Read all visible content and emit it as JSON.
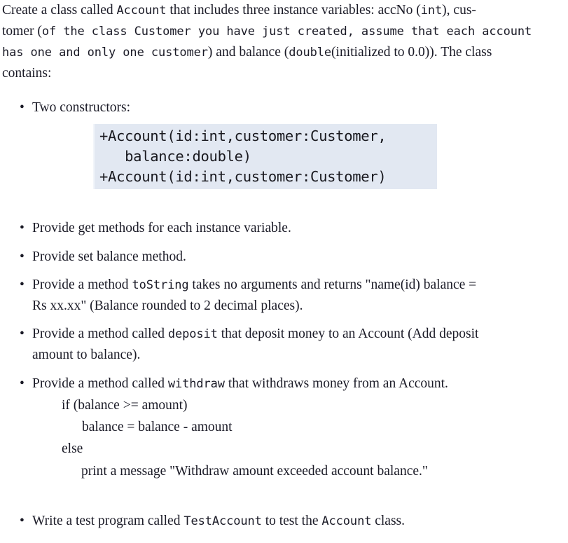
{
  "document": {
    "intro": {
      "lines": [
        [
          {
            "t": "Create a class called ",
            "s": "serif"
          },
          {
            "t": "Account",
            "s": "mono"
          },
          {
            "t": " that includes three instance variables: accNo (",
            "s": "serif"
          },
          {
            "t": "int",
            "s": "mono"
          },
          {
            "t": "), cus-",
            "s": "serif"
          }
        ],
        [
          {
            "t": "tomer (",
            "s": "serif"
          },
          {
            "t": "of the class Customer you have just created, assume that each account",
            "s": "mono"
          }
        ],
        [
          {
            "t": "has one and only one customer",
            "s": "mono"
          },
          {
            "t": ") and balance (",
            "s": "serif"
          },
          {
            "t": "double",
            "s": "mono"
          },
          {
            "t": "(initialized to 0.0)).  The class",
            "s": "serif"
          }
        ],
        [
          {
            "t": "contains:",
            "s": "serif"
          }
        ]
      ]
    },
    "bullets": {
      "two_constructors": [
        {
          "t": "Two constructors:",
          "s": "serif"
        }
      ],
      "get_methods": [
        {
          "t": "Provide get methods for each instance variable.",
          "s": "serif"
        }
      ],
      "set_balance": [
        {
          "t": "Provide set balance method.",
          "s": "serif"
        }
      ],
      "to_string_line1": [
        {
          "t": "Provide a method ",
          "s": "serif"
        },
        {
          "t": "toString",
          "s": "mono"
        },
        {
          "t": " takes no arguments and returns \"name(id) balance =",
          "s": "serif"
        }
      ],
      "to_string_line2": [
        {
          "t": "Rs xx.xx\" (Balance rounded to 2 decimal places).",
          "s": "serif"
        }
      ],
      "deposit_line1": [
        {
          "t": "Provide a method called ",
          "s": "serif"
        },
        {
          "t": "deposit",
          "s": "mono"
        },
        {
          "t": " that deposit money to an Account (Add deposit",
          "s": "serif"
        }
      ],
      "deposit_line2": [
        {
          "t": "amount to balance).",
          "s": "serif"
        }
      ],
      "withdraw": [
        {
          "t": "Provide a method called ",
          "s": "serif"
        },
        {
          "t": "withdraw",
          "s": "mono"
        },
        {
          "t": " that withdraws money from an Account.",
          "s": "serif"
        }
      ],
      "test_program": [
        {
          "t": "Write a test program called ",
          "s": "serif"
        },
        {
          "t": "TestAccount",
          "s": "mono"
        },
        {
          "t": " to test the ",
          "s": "serif"
        },
        {
          "t": "Account",
          "s": "mono"
        },
        {
          "t": " class.",
          "s": "serif"
        }
      ]
    },
    "code_box": {
      "lines": [
        "+Account(id:int,customer:Customer,",
        "   balance:double)",
        "+Account(id:int,customer:Customer)"
      ],
      "background_color": "#e2e8f2"
    },
    "pseudo_code": {
      "if_line": "if (balance >= amount)",
      "assign_line": "balance = balance - amount",
      "else_line": "else",
      "print_line": "print a message \"Withdraw amount exceeded account balance.\""
    },
    "bullet_glyph": "•"
  }
}
